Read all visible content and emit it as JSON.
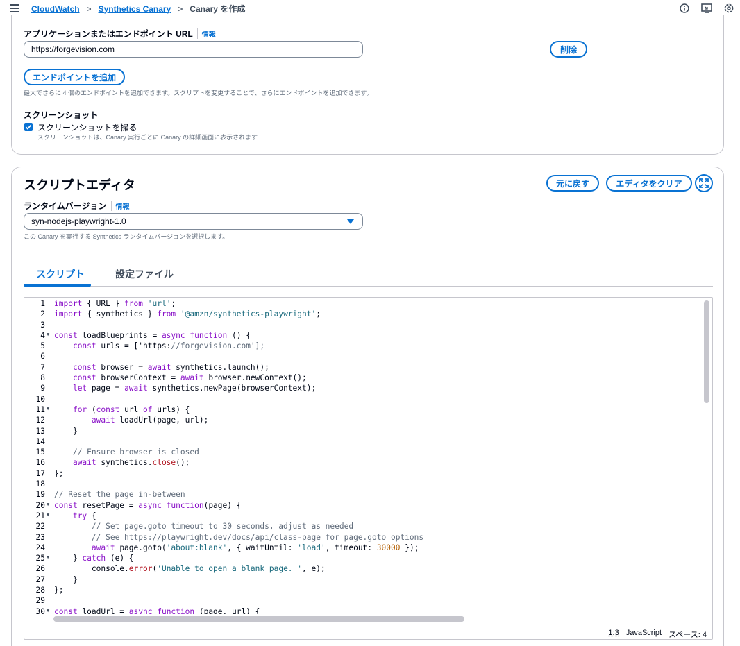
{
  "breadcrumb": {
    "items": [
      "CloudWatch",
      "Synthetics Canary"
    ],
    "current": "Canary を作成"
  },
  "top_icons": [
    "info-icon",
    "screen-icon",
    "settings-icon"
  ],
  "endpoint_section": {
    "url_label": "アプリケーションまたはエンドポイント URL",
    "info_label": "情報",
    "url_value": "https://forgevision.com",
    "delete_label": "削除",
    "add_label": "エンドポイントを追加",
    "add_hint": "最大でさらに 4 個のエンドポイントを追加できます。スクリプトを変更することで、さらにエンドポイントを追加できます。",
    "screenshot_heading": "スクリーンショット",
    "screenshot_checkbox_label": "スクリーンショットを撮る",
    "screenshot_checked": true,
    "screenshot_hint": "スクリーンショットは、Canary 実行ごとに Canary の詳細画面に表示されます"
  },
  "script_editor": {
    "title": "スクリプトエディタ",
    "revert_label": "元に戻す",
    "clear_label": "エディタをクリア",
    "runtime_label": "ランタイムバージョン",
    "info_label": "情報",
    "runtime_value": "syn-nodejs-playwright-1.0",
    "runtime_hint": "この Canary を実行する Synthetics ランタイムバージョンを選択します。",
    "tabs": [
      "スクリプト",
      "設定ファイル"
    ],
    "active_tab": "スクリプト",
    "code_lines": [
      "import { URL } from 'url';",
      "import { synthetics } from '@amzn/synthetics-playwright';",
      "",
      "const loadBlueprints = async function () {",
      "    const urls = ['https://forgevision.com'];",
      "",
      "    const browser = await synthetics.launch();",
      "    const browserContext = await browser.newContext();",
      "    let page = await synthetics.newPage(browserContext);",
      "",
      "    for (const url of urls) {",
      "        await loadUrl(page, url);",
      "    }",
      "",
      "    // Ensure browser is closed",
      "    await synthetics.close();",
      "};",
      "",
      "// Reset the page in-between",
      "const resetPage = async function(page) {",
      "    try {",
      "        // Set page.goto timeout to 30 seconds, adjust as needed",
      "        // See https://playwright.dev/docs/api/class-page for page.goto options",
      "        await page.goto('about:blank', { waitUntil: 'load', timeout: 30000 });",
      "    } catch (e) {",
      "        console.error('Unable to open a blank page. ', e);",
      "    }",
      "};",
      "",
      "const loadUrl = async function (page, url) {",
      ""
    ],
    "fold_lines": [
      4,
      11,
      20,
      21,
      25,
      30
    ],
    "status": {
      "cursor": "1:3",
      "language": "JavaScript",
      "indent": "スペース: 4"
    }
  }
}
